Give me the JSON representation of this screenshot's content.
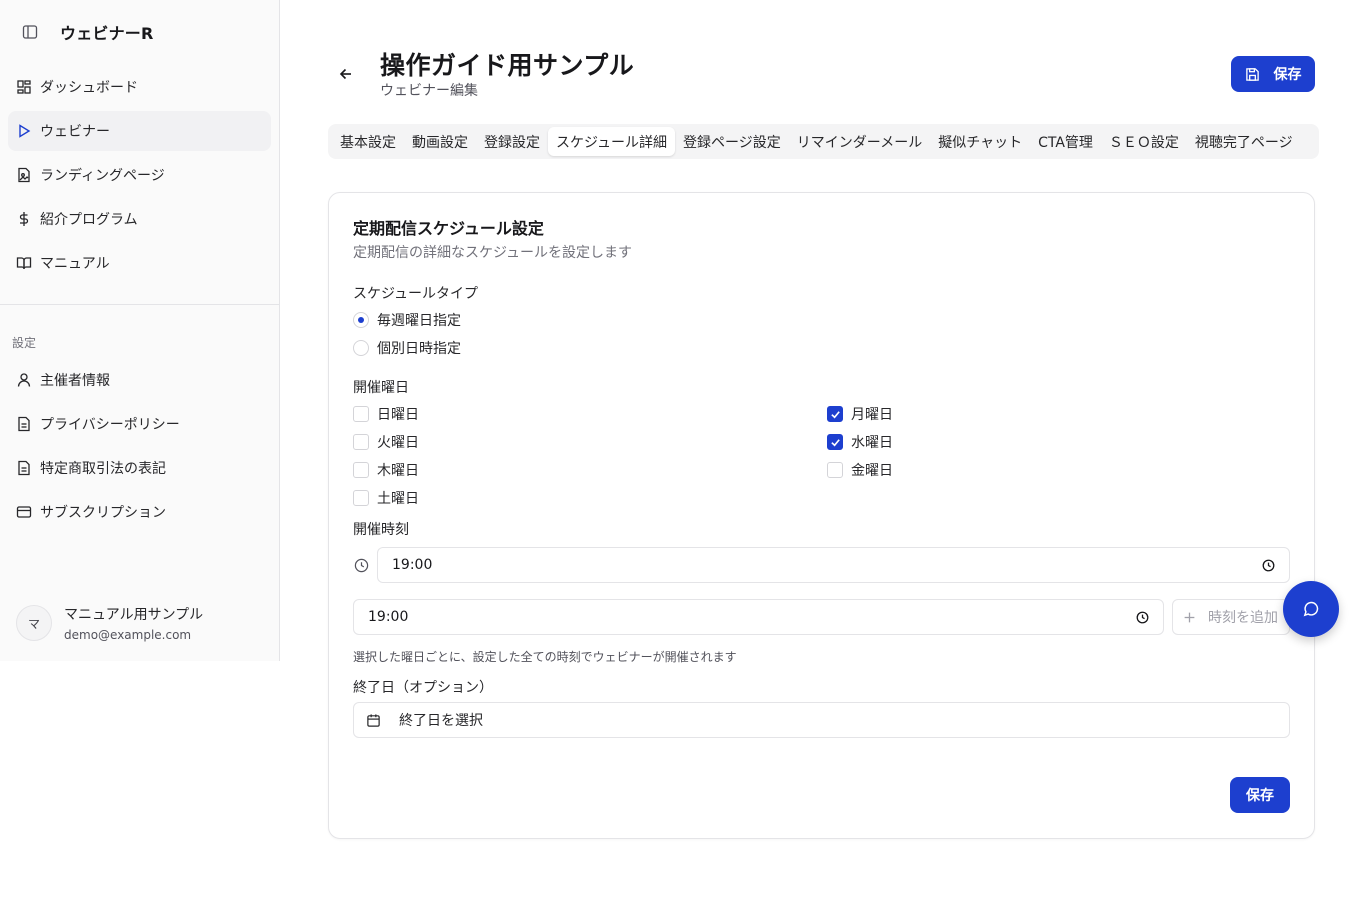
{
  "app": {
    "title": "ウェビナーR"
  },
  "sidebar": {
    "items": [
      {
        "label": "ダッシュボード",
        "icon": "dashboard-icon"
      },
      {
        "label": "ウェビナー",
        "icon": "play-icon",
        "active": true
      },
      {
        "label": "ランディングページ",
        "icon": "page-icon"
      },
      {
        "label": "紹介プログラム",
        "icon": "dollar-icon"
      },
      {
        "label": "マニュアル",
        "icon": "book-icon"
      }
    ],
    "section_label": "設定",
    "settings_items": [
      {
        "label": "主催者情報",
        "icon": "user-icon"
      },
      {
        "label": "プライバシーポリシー",
        "icon": "document-icon"
      },
      {
        "label": "特定商取引法の表記",
        "icon": "document-icon"
      },
      {
        "label": "サブスクリプション",
        "icon": "credit-card-icon"
      }
    ],
    "user": {
      "initial": "マ",
      "name": "マニュアル用サンプル",
      "email": "demo@example.com"
    }
  },
  "header": {
    "title": "操作ガイド用サンプル",
    "subtitle": "ウェビナー編集",
    "save_label": "保存"
  },
  "tabs": [
    {
      "label": "基本設定"
    },
    {
      "label": "動画設定"
    },
    {
      "label": "登録設定"
    },
    {
      "label": "スケジュール詳細",
      "active": true
    },
    {
      "label": "登録ページ設定"
    },
    {
      "label": "リマインダーメール"
    },
    {
      "label": "擬似チャット"
    },
    {
      "label": "CTA管理"
    },
    {
      "label": "ＳＥＯ設定"
    },
    {
      "label": "視聴完了ページ"
    }
  ],
  "card": {
    "title": "定期配信スケジュール設定",
    "description": "定期配信の詳細なスケジュールを設定します",
    "schedule_type_label": "スケジュールタイプ",
    "schedule_types": [
      {
        "label": "毎週曜日指定",
        "selected": true
      },
      {
        "label": "個別日時指定",
        "selected": false
      }
    ],
    "days_label": "開催曜日",
    "days": [
      {
        "label": "日曜日",
        "checked": false
      },
      {
        "label": "月曜日",
        "checked": true
      },
      {
        "label": "火曜日",
        "checked": false
      },
      {
        "label": "水曜日",
        "checked": true
      },
      {
        "label": "木曜日",
        "checked": false
      },
      {
        "label": "金曜日",
        "checked": false
      },
      {
        "label": "土曜日",
        "checked": false
      }
    ],
    "time_label": "開催時刻",
    "time_value_1": "19:00",
    "time_value_2": "19:00",
    "add_time_label": "時刻を追加",
    "time_hint": "選択した曜日ごとに、設定した全ての時刻でウェビナーが開催されます",
    "end_date_label": "終了日（オプション）",
    "end_date_placeholder": "終了日を選択",
    "save_label": "保存"
  },
  "colors": {
    "accent": "#1d3fcf",
    "border": "#e4e4e7",
    "muted": "#71717a"
  }
}
